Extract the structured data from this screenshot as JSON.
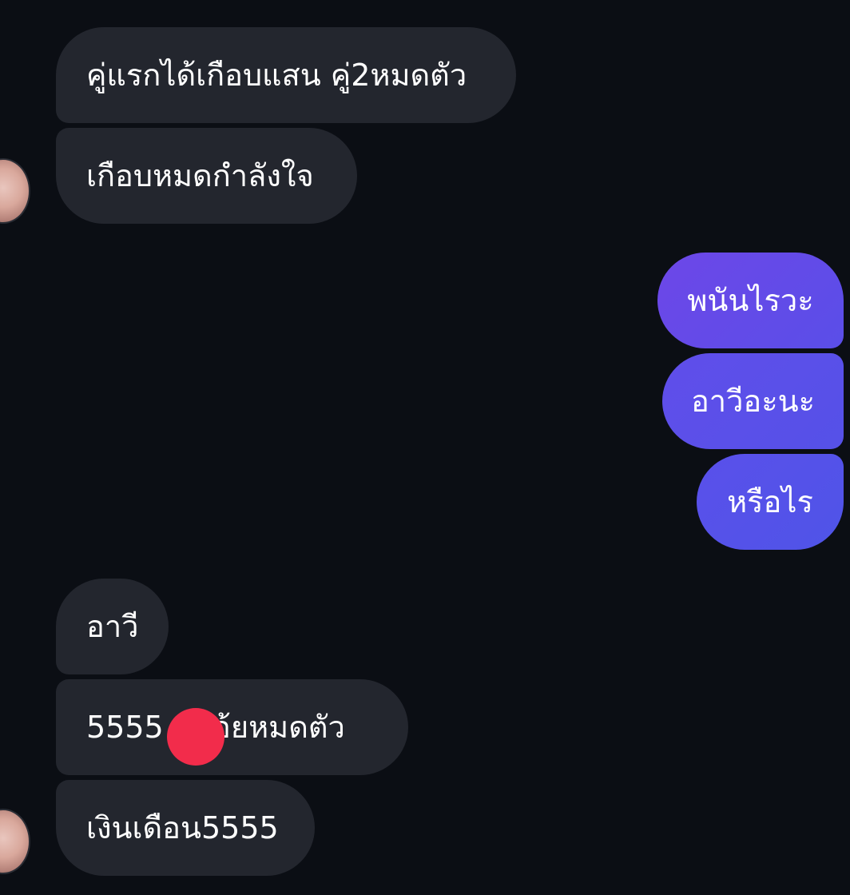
{
  "messages": [
    {
      "id": "m1",
      "side": "incoming",
      "text": "คู่แรกได้เกือบแสน คู่2หมดตัว"
    },
    {
      "id": "m2",
      "side": "incoming",
      "text": "เกือบหมดกำลังใจ"
    },
    {
      "id": "m3",
      "side": "outgoing",
      "text": "พนันไรวะ"
    },
    {
      "id": "m4",
      "side": "outgoing",
      "text": "อาวีอะนะ"
    },
    {
      "id": "m5",
      "side": "outgoing",
      "text": "หรือไร"
    },
    {
      "id": "m6",
      "side": "incoming",
      "text": "อาวี"
    },
    {
      "id": "m7",
      "side": "incoming",
      "text": "5555    เอ้ยหมดตัว"
    },
    {
      "id": "m8",
      "side": "incoming",
      "text": "เงินเดือน5555"
    }
  ],
  "colors": {
    "background": "#0b0e14",
    "incoming_bubble": "#23262e",
    "outgoing_gradient_start": "#6a4be8",
    "outgoing_gradient_end": "#4f52e8",
    "redaction_dot": "#f22c4b"
  }
}
